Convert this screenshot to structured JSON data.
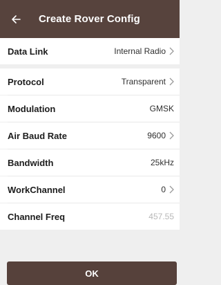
{
  "header": {
    "back_icon": "arrow-left-icon",
    "title": "Create Rover Config"
  },
  "data_link": {
    "label": "Data Link",
    "value": "Internal Radio"
  },
  "settings": [
    {
      "label": "Protocol",
      "value": "Transparent",
      "chevron": true
    },
    {
      "label": "Modulation",
      "value": "GMSK",
      "chevron": false
    },
    {
      "label": "Air Baud Rate",
      "value": "9600",
      "chevron": true
    },
    {
      "label": "Bandwidth",
      "value": "25kHz",
      "chevron": false
    },
    {
      "label": "WorkChannel",
      "value": "0",
      "chevron": true
    },
    {
      "label": "Channel Freq",
      "value": "457.55",
      "chevron": false
    }
  ],
  "footer": {
    "ok_label": "OK"
  },
  "colors": {
    "header_bg": "#57433d",
    "button_bg": "#56413b",
    "page_bg": "#efefef",
    "muted_value": "#b8b8b8"
  }
}
